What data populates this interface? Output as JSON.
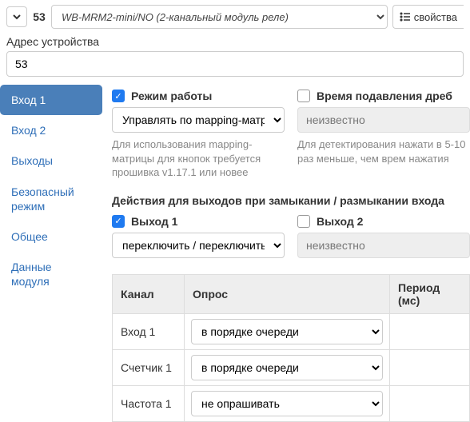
{
  "top": {
    "addr_num": "53",
    "device_sel": "WB-MRM2-mini/NO (2-канальный модуль реле)",
    "props_btn": "свойства"
  },
  "address": {
    "label": "Адрес устройства",
    "value": "53"
  },
  "sidebar": {
    "items": [
      "Вход 1",
      "Вход 2",
      "Выходы",
      "Безопасный режим",
      "Общее",
      "Данные модуля"
    ],
    "active_index": 0
  },
  "mode": {
    "chk_label": "Режим работы",
    "value": "Управлять по mapping-матрице",
    "hint": "Для использования mapping-матрицы для кнопок требуется прошивка v1.17.1 или новее"
  },
  "debounce": {
    "chk_label": "Время подавления дреб",
    "value": "неизвестно",
    "hint": "Для детектирования нажати в 5-10 раз меньше, чем врем нажатия"
  },
  "actions_title": "Действия для выходов при замыкании / размыкании входа",
  "out1": {
    "chk_label": "Выход 1",
    "value": "переключить / переключить"
  },
  "out2": {
    "chk_label": "Выход 2",
    "value": "неизвестно"
  },
  "table": {
    "head": {
      "channel": "Канал",
      "poll": "Опрос",
      "period": "Период (мс)"
    },
    "rows": [
      {
        "channel": "Вход 1",
        "poll": "в порядке очереди"
      },
      {
        "channel": "Счетчик 1",
        "poll": "в порядке очереди"
      },
      {
        "channel": "Частота 1",
        "poll": "не опрашивать"
      }
    ]
  }
}
